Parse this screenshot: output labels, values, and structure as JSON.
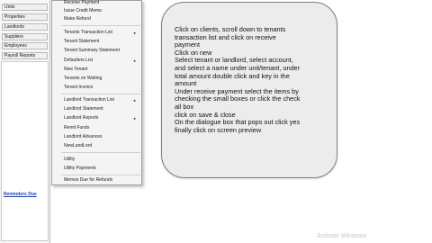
{
  "sidebar": {
    "items": [
      {
        "label": "Units"
      },
      {
        "label": "Properties"
      },
      {
        "label": "Landlords"
      },
      {
        "label": "Suppliers"
      },
      {
        "label": "Employees"
      },
      {
        "label": "Payroll Reports"
      }
    ],
    "reminders_link": "Reminders Due"
  },
  "menu": {
    "items": [
      {
        "label": "Receive Payment",
        "submenu": false
      },
      {
        "label": "Issue Credit Memo",
        "submenu": false
      },
      {
        "label": "Make Refund",
        "submenu": false
      },
      {
        "label": "Tenants Transaction List",
        "submenu": true
      },
      {
        "label": "Tenant Statement",
        "submenu": false
      },
      {
        "label": "Tenant Summary Statement",
        "submenu": false
      },
      {
        "label": "Defaulters List",
        "submenu": true
      },
      {
        "label": "New Tenant",
        "submenu": false
      },
      {
        "label": "Tenants on Waiting",
        "submenu": false
      },
      {
        "label": "Tenant Invoice",
        "submenu": false
      },
      {
        "label": "Landlord Transaction List",
        "submenu": true
      },
      {
        "label": "Landlord Statement",
        "submenu": false
      },
      {
        "label": "Landlord Reports",
        "submenu": true
      },
      {
        "label": "Remit Funds",
        "submenu": false
      },
      {
        "label": "Landlord Advances",
        "submenu": false
      },
      {
        "label": "NewLandLord",
        "submenu": false
      },
      {
        "label": "Utility",
        "submenu": false
      },
      {
        "label": "Utility Payments",
        "submenu": false
      },
      {
        "label": "Memos Due for Refunds",
        "submenu": false
      }
    ],
    "submenu_arrow": "►"
  },
  "note": {
    "text": "Click on clients, scroll down to tenants\ntransaction list and click on receive\npayment\nClick on new\nSelect tenant or landlord, select account,\nand select a name under unit/tenant, under\ntotal amount double click and key in the\namount\nUnder receive payment select the items by\nchecking the small boxes or click the check\nall box\nclick on save & close\nOn the dialogue box that pops out click yes\nfinally click on screen preview"
  },
  "watermark": "Activate Windows"
}
